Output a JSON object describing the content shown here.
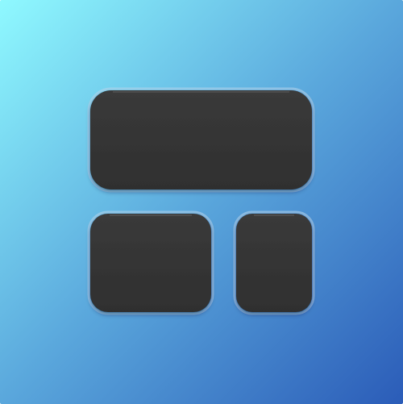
{
  "icon": {
    "name": "dashboard-layout-icon",
    "colors": {
      "gradient_start": "#8ff9ff",
      "gradient_mid": "#5aa7dc",
      "gradient_end": "#2b5cb8",
      "tile_fill": "#343434",
      "tile_highlight": "#5a5a5a",
      "tile_rim": "#9fb6cc"
    },
    "tiles": [
      {
        "id": "wide-top"
      },
      {
        "id": "bottom-left"
      },
      {
        "id": "bottom-right"
      }
    ]
  }
}
